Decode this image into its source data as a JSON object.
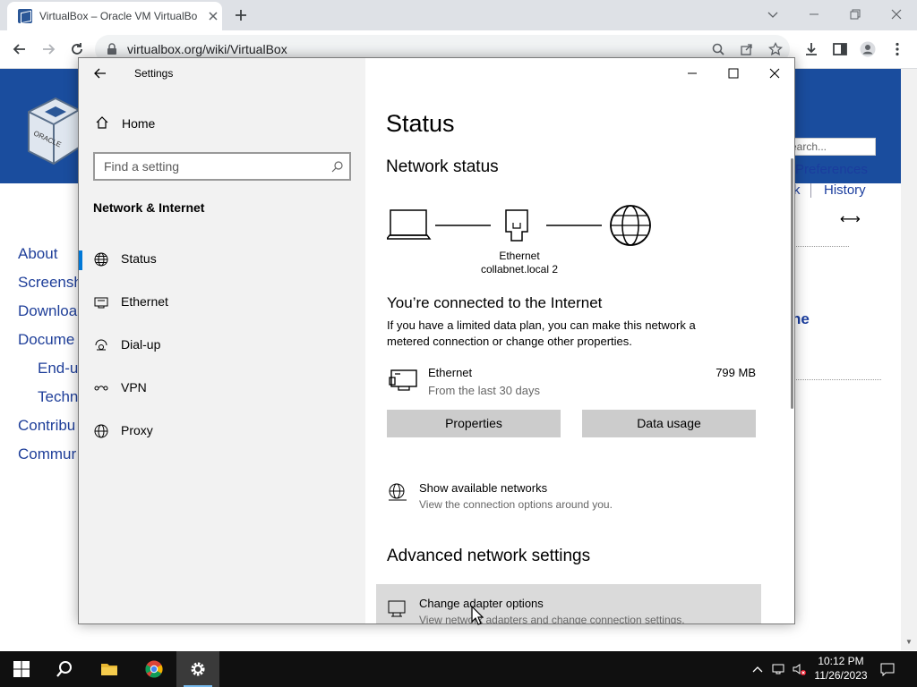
{
  "browser": {
    "tab_title": "VirtualBox – Oracle VM VirtualBo",
    "url": "virtualbox.org/wiki/VirtualBox"
  },
  "webpage": {
    "search_placeholder": "earch...",
    "top_links": [
      "Preferences",
      "k",
      "History"
    ],
    "heading_fragment": "ne",
    "nav": [
      "About",
      "Screensh",
      "Downloa",
      "Docume",
      "End-u",
      "Techn",
      "Contribu",
      "Commur"
    ]
  },
  "settings": {
    "window_title": "Settings",
    "home_label": "Home",
    "search_placeholder": "Find a setting",
    "section_title": "Network & Internet",
    "nav_items": [
      {
        "label": "Status",
        "icon": "status-globe-icon",
        "active": true
      },
      {
        "label": "Ethernet",
        "icon": "ethernet-icon",
        "active": false
      },
      {
        "label": "Dial-up",
        "icon": "dialup-icon",
        "active": false
      },
      {
        "label": "VPN",
        "icon": "vpn-icon",
        "active": false
      },
      {
        "label": "Proxy",
        "icon": "proxy-globe-icon",
        "active": false
      }
    ],
    "page_title": "Status",
    "network_status_heading": "Network status",
    "diagram_label_line1": "Ethernet",
    "diagram_label_line2": "collabnet.local 2",
    "connected_title": "You’re connected to the Internet",
    "connected_desc": "If you have a limited data plan, you can make this network a metered connection or change other properties.",
    "adapter": {
      "name": "Ethernet",
      "subtitle": "From the last 30 days",
      "usage": "799 MB"
    },
    "buttons": {
      "properties": "Properties",
      "data_usage": "Data usage"
    },
    "show_networks": {
      "title": "Show available networks",
      "subtitle": "View the connection options around you."
    },
    "advanced_heading": "Advanced network settings",
    "change_adapter": {
      "title": "Change adapter options",
      "subtitle": "View network adapters and change connection settings."
    }
  },
  "taskbar": {
    "time": "10:12 PM",
    "date": "11/26/2023"
  },
  "colors": {
    "accent": "#0078d7",
    "web_header": "#1a4d9e",
    "taskbar": "#101010"
  }
}
